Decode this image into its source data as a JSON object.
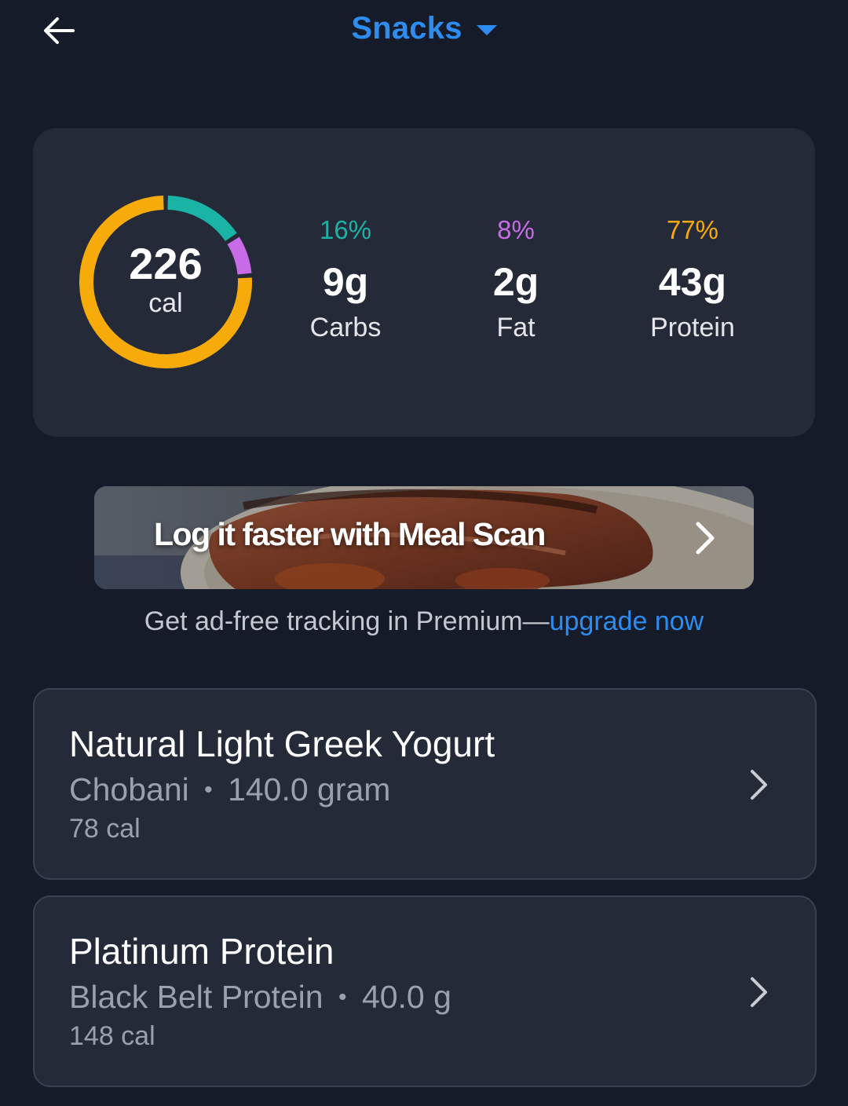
{
  "header": {
    "title": "Snacks",
    "back_icon": "arrow-left-icon",
    "dropdown_icon": "caret-down-icon"
  },
  "summary": {
    "calories_value": "226",
    "calories_unit": "cal",
    "ring_segments": [
      {
        "name": "carbs",
        "fraction": 0.16,
        "color": "#19b4a6"
      },
      {
        "name": "fat",
        "fraction": 0.08,
        "color": "#c86be6"
      },
      {
        "name": "protein",
        "fraction": 0.77,
        "color": "#f7ab0a"
      }
    ],
    "macros": [
      {
        "percent": "16%",
        "grams": "9g",
        "label": "Carbs",
        "color": "#19b4a6"
      },
      {
        "percent": "8%",
        "grams": "2g",
        "label": "Fat",
        "color": "#c86be6"
      },
      {
        "percent": "77%",
        "grams": "43g",
        "label": "Protein",
        "color": "#f7ab0a"
      }
    ]
  },
  "ad": {
    "text": "Log it faster with Meal Scan",
    "chevron_icon": "chevron-right-icon"
  },
  "premium": {
    "prefix": "Get ad-free tracking in Premium—",
    "link": "upgrade now"
  },
  "foods": [
    {
      "name": "Natural Light Greek Yogurt",
      "brand": "Chobani",
      "separator": "•",
      "serving": "140.0 gram",
      "calories": "78 cal"
    },
    {
      "name": "Platinum Protein",
      "brand": "Black Belt Protein",
      "separator": "•",
      "serving": "40.0 g",
      "calories": "148 cal"
    }
  ],
  "colors": {
    "background": "#151b28",
    "card": "#242a38",
    "accent": "#2d8cf0"
  }
}
